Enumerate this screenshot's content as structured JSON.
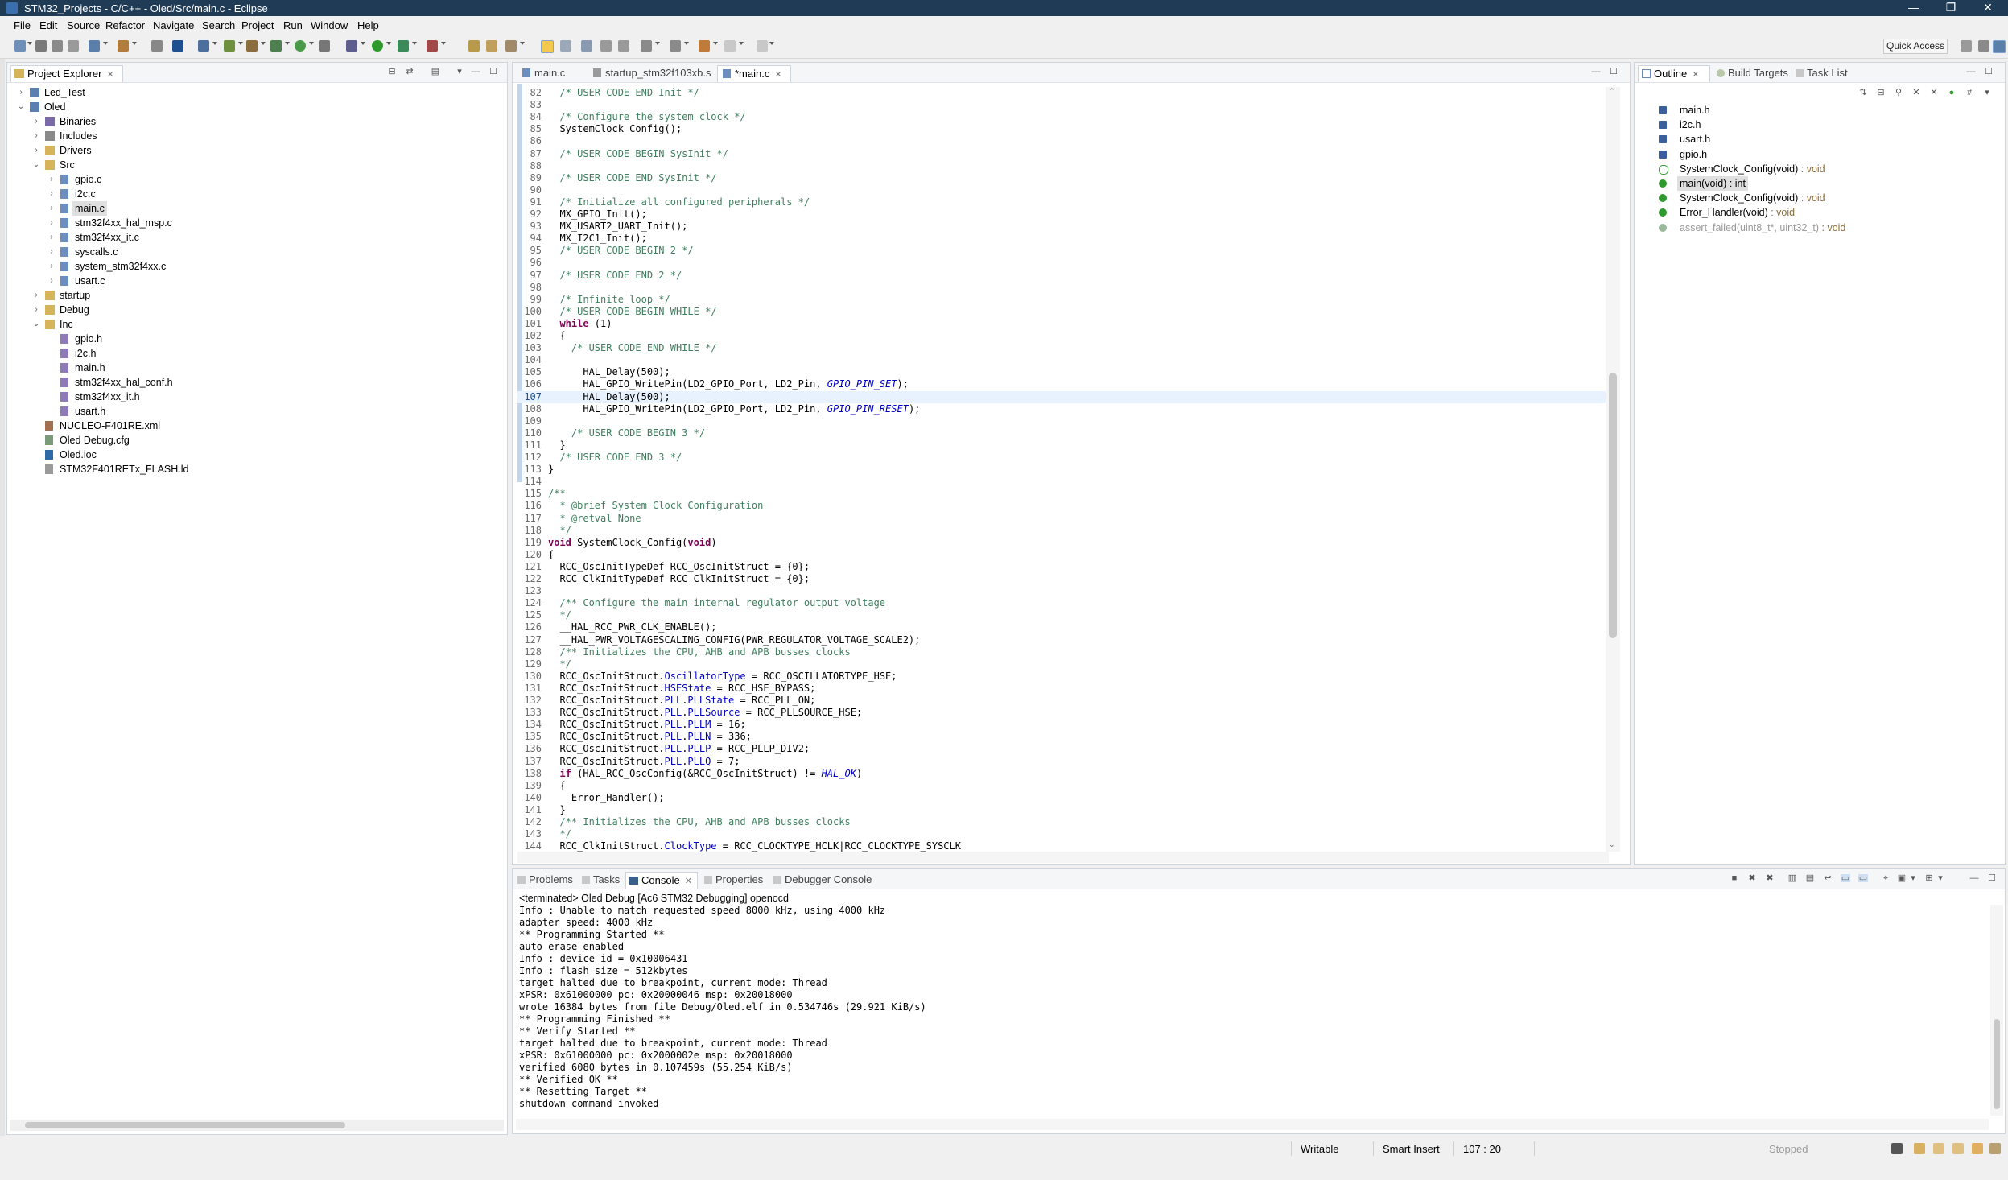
{
  "window": {
    "title": "STM32_Projects - C/C++ - Oled/Src/main.c - Eclipse",
    "controls": [
      "—",
      "❐",
      "✕"
    ]
  },
  "menu": [
    "File",
    "Edit",
    "Source",
    "Refactor",
    "Navigate",
    "Search",
    "Project",
    "Run",
    "Window",
    "Help"
  ],
  "toolbar": {
    "quick_access": "Quick Access"
  },
  "project_explorer": {
    "title": "Project Explorer",
    "items": [
      {
        "label": "Led_Test",
        "depth": 0,
        "twisty": "›",
        "icon": "project-icon"
      },
      {
        "label": "Oled",
        "depth": 0,
        "twisty": "⌄",
        "icon": "project-icon"
      },
      {
        "label": "Binaries",
        "depth": 1,
        "twisty": "›",
        "icon": "binaries-icon"
      },
      {
        "label": "Includes",
        "depth": 1,
        "twisty": "›",
        "icon": "includes-icon"
      },
      {
        "label": "Drivers",
        "depth": 1,
        "twisty": "›",
        "icon": "folder-icon"
      },
      {
        "label": "Src",
        "depth": 1,
        "twisty": "⌄",
        "icon": "folder-icon"
      },
      {
        "label": "gpio.c",
        "depth": 2,
        "twisty": "›",
        "icon": "c-file-icon"
      },
      {
        "label": "i2c.c",
        "depth": 2,
        "twisty": "›",
        "icon": "c-file-icon"
      },
      {
        "label": "main.c",
        "depth": 2,
        "twisty": "›",
        "icon": "c-file-icon",
        "selected": true
      },
      {
        "label": "stm32f4xx_hal_msp.c",
        "depth": 2,
        "twisty": "›",
        "icon": "c-file-icon"
      },
      {
        "label": "stm32f4xx_it.c",
        "depth": 2,
        "twisty": "›",
        "icon": "c-file-icon"
      },
      {
        "label": "syscalls.c",
        "depth": 2,
        "twisty": "›",
        "icon": "c-file-icon"
      },
      {
        "label": "system_stm32f4xx.c",
        "depth": 2,
        "twisty": "›",
        "icon": "c-file-icon"
      },
      {
        "label": "usart.c",
        "depth": 2,
        "twisty": "›",
        "icon": "c-file-icon"
      },
      {
        "label": "startup",
        "depth": 1,
        "twisty": "›",
        "icon": "folder-icon"
      },
      {
        "label": "Debug",
        "depth": 1,
        "twisty": "›",
        "icon": "folder-icon"
      },
      {
        "label": "Inc",
        "depth": 1,
        "twisty": "⌄",
        "icon": "folder-icon"
      },
      {
        "label": "gpio.h",
        "depth": 2,
        "twisty": "",
        "icon": "h-file-icon"
      },
      {
        "label": "i2c.h",
        "depth": 2,
        "twisty": "",
        "icon": "h-file-icon"
      },
      {
        "label": "main.h",
        "depth": 2,
        "twisty": "",
        "icon": "h-file-icon"
      },
      {
        "label": "stm32f4xx_hal_conf.h",
        "depth": 2,
        "twisty": "",
        "icon": "h-file-icon"
      },
      {
        "label": "stm32f4xx_it.h",
        "depth": 2,
        "twisty": "",
        "icon": "h-file-icon"
      },
      {
        "label": "usart.h",
        "depth": 2,
        "twisty": "",
        "icon": "h-file-icon"
      },
      {
        "label": "NUCLEO-F401RE.xml",
        "depth": 1,
        "twisty": "",
        "icon": "xml-file-icon"
      },
      {
        "label": "Oled Debug.cfg",
        "depth": 1,
        "twisty": "",
        "icon": "cfg-file-icon"
      },
      {
        "label": "Oled.ioc",
        "depth": 1,
        "twisty": "",
        "icon": "ioc-file-icon"
      },
      {
        "label": "STM32F401RETx_FLASH.ld",
        "depth": 1,
        "twisty": "",
        "icon": "ld-file-icon"
      }
    ]
  },
  "editor": {
    "tabs": [
      {
        "label": "main.c",
        "active": false
      },
      {
        "label": "startup_stm32f103xb.s",
        "active": false
      },
      {
        "label": "*main.c",
        "active": true
      }
    ],
    "current_line": 107,
    "lines": [
      {
        "n": "82",
        "segs": [
          [
            "  ",
            ""
          ],
          [
            "/* USER CODE END Init */",
            "cmt"
          ]
        ]
      },
      {
        "n": "83",
        "segs": []
      },
      {
        "n": "84",
        "segs": [
          [
            "  ",
            ""
          ],
          [
            "/* Configure the system clock */",
            "cmt"
          ]
        ]
      },
      {
        "n": "85",
        "segs": [
          [
            "  SystemClock_Config();",
            ""
          ]
        ]
      },
      {
        "n": "86",
        "segs": []
      },
      {
        "n": "87",
        "segs": [
          [
            "  ",
            ""
          ],
          [
            "/* USER CODE BEGIN SysInit */",
            "cmt"
          ]
        ]
      },
      {
        "n": "88",
        "segs": []
      },
      {
        "n": "89",
        "segs": [
          [
            "  ",
            ""
          ],
          [
            "/* USER CODE END SysInit */",
            "cmt"
          ]
        ]
      },
      {
        "n": "90",
        "segs": []
      },
      {
        "n": "91",
        "segs": [
          [
            "  ",
            ""
          ],
          [
            "/* Initialize all configured peripherals */",
            "cmt"
          ]
        ]
      },
      {
        "n": "92",
        "segs": [
          [
            "  MX_GPIO_Init();",
            ""
          ]
        ]
      },
      {
        "n": "93",
        "segs": [
          [
            "  MX_USART2_UART_Init();",
            ""
          ]
        ]
      },
      {
        "n": "94",
        "segs": [
          [
            "  MX_I2C1_Init();",
            ""
          ]
        ]
      },
      {
        "n": "95",
        "segs": [
          [
            "  ",
            ""
          ],
          [
            "/* USER CODE BEGIN 2 */",
            "cmt"
          ]
        ]
      },
      {
        "n": "96",
        "segs": []
      },
      {
        "n": "97",
        "segs": [
          [
            "  ",
            ""
          ],
          [
            "/* USER CODE END 2 */",
            "cmt"
          ]
        ]
      },
      {
        "n": "98",
        "segs": []
      },
      {
        "n": "99",
        "segs": [
          [
            "  ",
            ""
          ],
          [
            "/* Infinite loop */",
            "cmt"
          ]
        ]
      },
      {
        "n": "100",
        "segs": [
          [
            "  ",
            ""
          ],
          [
            "/* USER CODE BEGIN WHILE */",
            "cmt"
          ]
        ]
      },
      {
        "n": "101",
        "segs": [
          [
            "  ",
            ""
          ],
          [
            "while",
            "kw"
          ],
          [
            " (1)",
            ""
          ]
        ]
      },
      {
        "n": "102",
        "segs": [
          [
            "  {",
            ""
          ]
        ]
      },
      {
        "n": "103",
        "segs": [
          [
            "    ",
            ""
          ],
          [
            "/* USER CODE END WHILE */",
            "cmt"
          ]
        ]
      },
      {
        "n": "104",
        "segs": []
      },
      {
        "n": "105",
        "segs": [
          [
            "      HAL_Delay(500);",
            ""
          ]
        ]
      },
      {
        "n": "106",
        "segs": [
          [
            "      HAL_GPIO_WritePin(LD2_GPIO_Port, LD2_Pin, ",
            ""
          ],
          [
            "GPIO_PIN_SET",
            "it"
          ],
          [
            ");",
            ""
          ]
        ]
      },
      {
        "n": "107",
        "segs": [
          [
            "      HAL_Delay(500);",
            ""
          ]
        ]
      },
      {
        "n": "108",
        "segs": [
          [
            "      HAL_GPIO_WritePin(LD2_GPIO_Port, LD2_Pin, ",
            ""
          ],
          [
            "GPIO_PIN_RESET",
            "it"
          ],
          [
            ");",
            ""
          ]
        ]
      },
      {
        "n": "109",
        "segs": []
      },
      {
        "n": "110",
        "segs": [
          [
            "    ",
            ""
          ],
          [
            "/* USER CODE BEGIN 3 */",
            "cmt"
          ]
        ]
      },
      {
        "n": "111",
        "segs": [
          [
            "  }",
            ""
          ]
        ]
      },
      {
        "n": "112",
        "segs": [
          [
            "  ",
            ""
          ],
          [
            "/* USER CODE END 3 */",
            "cmt"
          ]
        ]
      },
      {
        "n": "113",
        "segs": [
          [
            "}",
            ""
          ]
        ]
      },
      {
        "n": "114",
        "segs": []
      },
      {
        "n": "115",
        "segs": [
          [
            "/**",
            "cmt"
          ]
        ]
      },
      {
        "n": "116",
        "segs": [
          [
            "  * @brief System Clock Configuration",
            "cmt"
          ]
        ]
      },
      {
        "n": "117",
        "segs": [
          [
            "  * @retval None",
            "cmt"
          ]
        ]
      },
      {
        "n": "118",
        "segs": [
          [
            "  */",
            "cmt"
          ]
        ]
      },
      {
        "n": "119",
        "segs": [
          [
            "void",
            "kw"
          ],
          [
            " SystemClock_Config(",
            ""
          ],
          [
            "void",
            "kw"
          ],
          [
            ")",
            ""
          ]
        ]
      },
      {
        "n": "120",
        "segs": [
          [
            "{",
            ""
          ]
        ]
      },
      {
        "n": "121",
        "segs": [
          [
            "  RCC_OscInitTypeDef RCC_OscInitStruct = {0};",
            ""
          ]
        ]
      },
      {
        "n": "122",
        "segs": [
          [
            "  RCC_ClkInitTypeDef RCC_ClkInitStruct = {0};",
            ""
          ]
        ]
      },
      {
        "n": "123",
        "segs": []
      },
      {
        "n": "124",
        "segs": [
          [
            "  ",
            ""
          ],
          [
            "/** Configure the main internal regulator output voltage",
            "cmt"
          ]
        ]
      },
      {
        "n": "125",
        "segs": [
          [
            "  ",
            ""
          ],
          [
            "*/",
            "cmt"
          ]
        ]
      },
      {
        "n": "126",
        "segs": [
          [
            "  __HAL_RCC_PWR_CLK_ENABLE();",
            ""
          ]
        ]
      },
      {
        "n": "127",
        "segs": [
          [
            "  __HAL_PWR_VOLTAGESCALING_CONFIG(PWR_REGULATOR_VOLTAGE_SCALE2);",
            ""
          ]
        ]
      },
      {
        "n": "128",
        "segs": [
          [
            "  ",
            ""
          ],
          [
            "/** Initializes the CPU, AHB and APB busses clocks",
            "cmt"
          ]
        ]
      },
      {
        "n": "129",
        "segs": [
          [
            "  ",
            ""
          ],
          [
            "*/",
            "cmt"
          ]
        ]
      },
      {
        "n": "130",
        "segs": [
          [
            "  RCC_OscInitStruct.",
            ""
          ],
          [
            "OscillatorType",
            "fld"
          ],
          [
            " = RCC_OSCILLATORTYPE_HSE;",
            ""
          ]
        ]
      },
      {
        "n": "131",
        "segs": [
          [
            "  RCC_OscInitStruct.",
            ""
          ],
          [
            "HSEState",
            "fld"
          ],
          [
            " = RCC_HSE_BYPASS;",
            ""
          ]
        ]
      },
      {
        "n": "132",
        "segs": [
          [
            "  RCC_OscInitStruct.",
            ""
          ],
          [
            "PLL",
            "fld"
          ],
          [
            ".",
            ""
          ],
          [
            "PLLState",
            "fld"
          ],
          [
            " = RCC_PLL_ON;",
            ""
          ]
        ]
      },
      {
        "n": "133",
        "segs": [
          [
            "  RCC_OscInitStruct.",
            ""
          ],
          [
            "PLL",
            "fld"
          ],
          [
            ".",
            ""
          ],
          [
            "PLLSource",
            "fld"
          ],
          [
            " = RCC_PLLSOURCE_HSE;",
            ""
          ]
        ]
      },
      {
        "n": "134",
        "segs": [
          [
            "  RCC_OscInitStruct.",
            ""
          ],
          [
            "PLL",
            "fld"
          ],
          [
            ".",
            ""
          ],
          [
            "PLLM",
            "fld"
          ],
          [
            " = 16;",
            ""
          ]
        ]
      },
      {
        "n": "135",
        "segs": [
          [
            "  RCC_OscInitStruct.",
            ""
          ],
          [
            "PLL",
            "fld"
          ],
          [
            ".",
            ""
          ],
          [
            "PLLN",
            "fld"
          ],
          [
            " = 336;",
            ""
          ]
        ]
      },
      {
        "n": "136",
        "segs": [
          [
            "  RCC_OscInitStruct.",
            ""
          ],
          [
            "PLL",
            "fld"
          ],
          [
            ".",
            ""
          ],
          [
            "PLLP",
            "fld"
          ],
          [
            " = RCC_PLLP_DIV2;",
            ""
          ]
        ]
      },
      {
        "n": "137",
        "segs": [
          [
            "  RCC_OscInitStruct.",
            ""
          ],
          [
            "PLL",
            "fld"
          ],
          [
            ".",
            ""
          ],
          [
            "PLLQ",
            "fld"
          ],
          [
            " = 7;",
            ""
          ]
        ]
      },
      {
        "n": "138",
        "segs": [
          [
            "  ",
            ""
          ],
          [
            "if",
            "kw"
          ],
          [
            " (HAL_RCC_OscConfig(&RCC_OscInitStruct) != ",
            ""
          ],
          [
            "HAL_OK",
            "it"
          ],
          [
            ")",
            ""
          ]
        ]
      },
      {
        "n": "139",
        "segs": [
          [
            "  {",
            ""
          ]
        ]
      },
      {
        "n": "140",
        "segs": [
          [
            "    Error_Handler();",
            ""
          ]
        ]
      },
      {
        "n": "141",
        "segs": [
          [
            "  }",
            ""
          ]
        ]
      },
      {
        "n": "142",
        "segs": [
          [
            "  ",
            ""
          ],
          [
            "/** Initializes the CPU, AHB and APB busses clocks",
            "cmt"
          ]
        ]
      },
      {
        "n": "143",
        "segs": [
          [
            "  ",
            ""
          ],
          [
            "*/",
            "cmt"
          ]
        ]
      },
      {
        "n": "144",
        "segs": [
          [
            "  RCC_ClkInitStruct.",
            ""
          ],
          [
            "ClockType",
            "fld"
          ],
          [
            " = RCC_CLOCKTYPE_HCLK|RCC_CLOCKTYPE_SYSCLK",
            ""
          ]
        ]
      }
    ]
  },
  "outline": {
    "tabs": [
      "Outline",
      "Build Targets",
      "Task List"
    ],
    "items": [
      {
        "label": "main.h",
        "ret": "",
        "icon": "include-icon"
      },
      {
        "label": "i2c.h",
        "ret": "",
        "icon": "include-icon"
      },
      {
        "label": "usart.h",
        "ret": "",
        "icon": "include-icon"
      },
      {
        "label": "gpio.h",
        "ret": "",
        "icon": "include-icon"
      },
      {
        "label": "SystemClock_Config(void)",
        "ret": " : void",
        "icon": "function-decl-icon"
      },
      {
        "label": "main(void) : int",
        "ret": "",
        "icon": "function-icon",
        "selected": true
      },
      {
        "label": "SystemClock_Config(void)",
        "ret": " : void",
        "icon": "function-icon"
      },
      {
        "label": "Error_Handler(void)",
        "ret": " : void",
        "icon": "function-icon"
      },
      {
        "label": "assert_failed(uint8_t*, uint32_t)",
        "ret": " : void",
        "icon": "disabled-function-icon",
        "disabled": true
      }
    ]
  },
  "console": {
    "tabs": [
      "Problems",
      "Tasks",
      "Console",
      "Properties",
      "Debugger Console"
    ],
    "active_tab": "Console",
    "header": "<terminated> Oled Debug [Ac6 STM32 Debugging] openocd",
    "lines": [
      "Info : Unable to match requested speed 8000 kHz, using 4000 kHz",
      "adapter speed: 4000 kHz",
      "** Programming Started **",
      "auto erase enabled",
      "Info : device id = 0x10006431",
      "Info : flash size = 512kbytes",
      "target halted due to breakpoint, current mode: Thread",
      "xPSR: 0x61000000 pc: 0x20000046 msp: 0x20018000",
      "wrote 16384 bytes from file Debug/Oled.elf in 0.534746s (29.921 KiB/s)",
      "** Programming Finished **",
      "** Verify Started **",
      "target halted due to breakpoint, current mode: Thread",
      "xPSR: 0x61000000 pc: 0x2000002e msp: 0x20018000",
      "verified 6080 bytes in 0.107459s (55.254 KiB/s)",
      "** Verified OK **",
      "** Resetting Target **",
      "shutdown command invoked"
    ]
  },
  "status": {
    "writable": "Writable",
    "insert_mode": "Smart Insert",
    "position": "107 : 20",
    "launch": "Stopped"
  }
}
